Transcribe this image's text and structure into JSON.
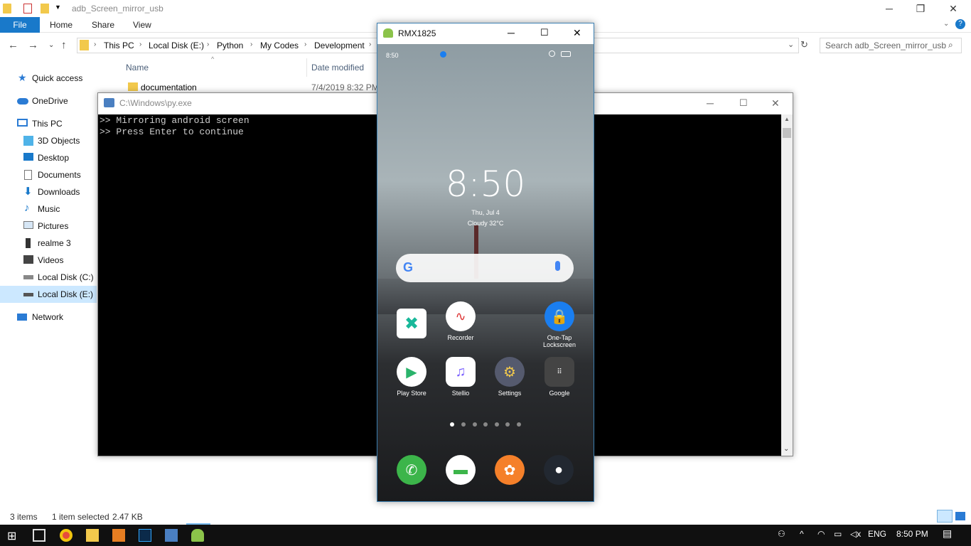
{
  "explorer": {
    "title": "adb_Screen_mirror_usb",
    "ribbon_tabs": [
      "File",
      "Home",
      "Share",
      "View"
    ],
    "breadcrumbs": [
      "This PC",
      "Local Disk (E:)",
      "Python",
      "My Codes",
      "Development"
    ],
    "search_placeholder": "Search adb_Screen_mirror_usb",
    "columns": {
      "name": "Name",
      "date": "Date modified"
    },
    "files": [
      {
        "name": "documentation",
        "date": "7/4/2019 8:32 PM"
      }
    ],
    "sidebar": [
      {
        "label": "Quick access",
        "icon": "star-icon"
      },
      {
        "label": "OneDrive",
        "icon": "cloud-icon"
      },
      {
        "label": "This PC",
        "icon": "computer-icon"
      },
      {
        "label": "3D Objects",
        "icon": "cube-icon"
      },
      {
        "label": "Desktop",
        "icon": "desktop-icon"
      },
      {
        "label": "Documents",
        "icon": "document-icon"
      },
      {
        "label": "Downloads",
        "icon": "download-icon"
      },
      {
        "label": "Music",
        "icon": "music-icon"
      },
      {
        "label": "Pictures",
        "icon": "picture-icon"
      },
      {
        "label": "realme 3",
        "icon": "phone-icon"
      },
      {
        "label": "Videos",
        "icon": "video-icon"
      },
      {
        "label": "Local Disk (C:)",
        "icon": "drive-icon"
      },
      {
        "label": "Local Disk (E:)",
        "icon": "drive-icon"
      },
      {
        "label": "Network",
        "icon": "network-icon"
      }
    ],
    "status": {
      "items": "3 items",
      "selected": "1 item selected",
      "size": "2.47 KB"
    }
  },
  "console": {
    "title": "C:\\Windows\\py.exe",
    "lines": [
      ">> Mirroring android screen",
      ">> Press Enter to continue"
    ]
  },
  "phone_window": {
    "title": "RMX1825",
    "status_time": "8:50",
    "clock": "8:50",
    "date": "Thu, Jul 4",
    "weather": "Cloudy 32°C",
    "apps_row1": [
      {
        "label": "",
        "icon": "close-circle-icon",
        "color": "#19b89a"
      },
      {
        "label": "Recorder",
        "icon": "waveform-icon",
        "color": "#ffffff"
      },
      {
        "label": "",
        "icon": "",
        "color": ""
      },
      {
        "label": "One-Tap Lockscreen",
        "icon": "lock-icon",
        "color": "#1a7ef0"
      }
    ],
    "apps_row2": [
      {
        "label": "Play Store",
        "icon": "play-store-icon",
        "color": "#ffffff"
      },
      {
        "label": "Stellio",
        "icon": "stellio-icon",
        "color": "#ffffff"
      },
      {
        "label": "Settings",
        "icon": "gear-icon",
        "color": "#555a6e"
      },
      {
        "label": "Google",
        "icon": "folder-icon",
        "color": "#444444"
      }
    ],
    "dock": [
      {
        "icon": "phone-call-icon",
        "color": "#3cb54a"
      },
      {
        "icon": "message-icon",
        "color": "#ffffff"
      },
      {
        "icon": "uc-browser-icon",
        "color": "#f5802a"
      },
      {
        "icon": "camera-icon",
        "color": "#222831"
      }
    ]
  },
  "taskbar": {
    "language": "ENG",
    "time": "8:50 PM"
  }
}
